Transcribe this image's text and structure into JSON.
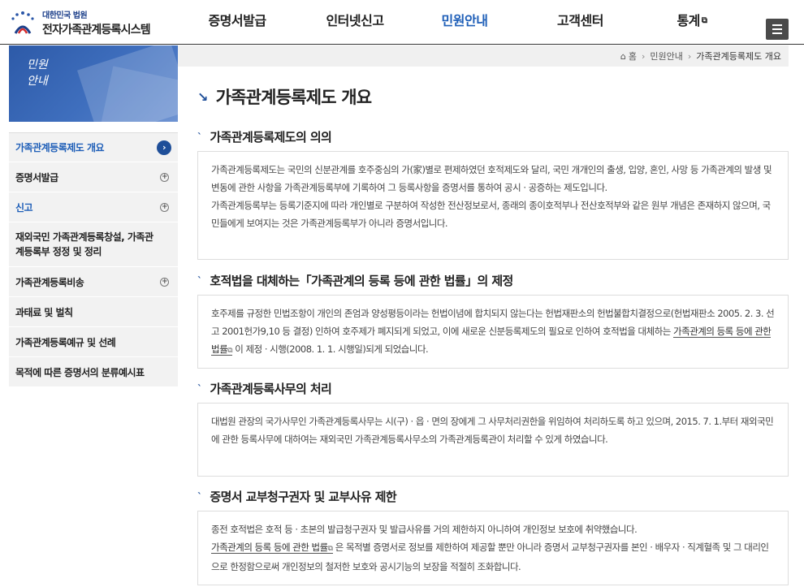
{
  "header": {
    "logo_sub": "대한민국 법원",
    "logo_main": "전자가족관계등록시스템",
    "nav": [
      {
        "label": "증명서발급"
      },
      {
        "label": "인터넷신고"
      },
      {
        "label": "민원안내"
      },
      {
        "label": "고객센터"
      },
      {
        "label": "통계"
      }
    ],
    "ext_glyph": "⧉"
  },
  "sidebar": {
    "banner_line1": "민원",
    "banner_line2": "안내",
    "items": [
      {
        "label": "가족관계등록제도 개요",
        "icon": "›"
      },
      {
        "label": "증명서발급",
        "icon": "+"
      },
      {
        "label": "신고",
        "icon": "+"
      },
      {
        "label": "재외국민 가족관계등록창설, 가족관계등록부 정정 및 정리"
      },
      {
        "label": "가족관계등록비송",
        "icon": "+"
      },
      {
        "label": "과태료 및 벌칙"
      },
      {
        "label": "가족관계등록예규 및 선례"
      },
      {
        "label": "목적에 따른 증명서의 분류예시표"
      }
    ]
  },
  "breadcrumb": {
    "home_icon": "⌂",
    "home": "홈",
    "sep": "›",
    "level1": "민원안내",
    "current": "가족관계등록제도 개요"
  },
  "content": {
    "title_mark": "↘",
    "section_mark": "`",
    "title": "가족관계등록제도 개요",
    "sections": [
      {
        "heading": "가족관계등록제도의 의의",
        "p1": "가족관계등록제도는 국민의 신분관계를 호주중심의 가(家)별로 편제하였던 호적제도와 달리, 국민 개개인의 출생, 입양, 혼인, 사망 등 가족관계의 발생 및 변동에 관한 사항을 가족관계등록부에 기록하여 그 등록사항을 증명서를 통하여 공시 · 공증하는 제도입니다.",
        "p2": "가족관계등록부는 등록기준지에 따라 개인별로 구분하여 작성한 전산정보로서, 종래의 종이호적부나 전산호적부와 같은 원부 개념은 존재하지 않으며, 국민들에게 보여지는 것은 가족관계등록부가 아니라 증명서입니다."
      },
      {
        "heading": "호적법을 대체하는「가족관계의 등록 등에 관한 법률」의 제정",
        "p1_a": "호주제를 규정한 민법조항이 개인의 존엄과 양성평등이라는 헌법이념에 합치되지 않는다는 헌법재판소의 헌법불합치결정으로(헌법재판소 2005. 2. 3. 선고 2001헌가9,10 등 결정) 인하여 호주제가 폐지되게 되었고, 이에 새로운 신분등록제도의 필요로 인하여 호적법을 대체하는",
        "p1_link": "가족관계의 등록 등에 관한 법률",
        "p1_b": "이 제정 · 시행(2008. 1. 1. 시행일)되게 되었습니다."
      },
      {
        "heading": "가족관계등록사무의 처리",
        "p1": "대법원 관장의 국가사무인 가족관계등록사무는 시(구) · 읍 · 면의 장에게 그 사무처리권한을 위임하여 처리하도록 하고 있으며, 2015. 7. 1.부터 재외국민에 관한 등록사무에 대하여는 재외국민 가족관계등록사무소의 가족관계등록관이 처리할 수 있게 하였습니다."
      },
      {
        "heading": "증명서 교부청구권자 및 교부사유 제한",
        "p1": "종전 호적법은 호적 등 · 초본의 발급청구권자 및 발급사유를 거의 제한하지 아니하여 개인정보 보호에 취약했습니다.",
        "p2_link": "가족관계의 등록 등에 관한 법률",
        "p2_b": "은 목적별 증명서로 정보를 제한하여 제공할 뿐만 아니라 증명서 교부청구권자를 본인 · 배우자 · 직계혈족 및 그 대리인으로 한정함으로써 개인정보의 철저한 보호와 공시기능의 보장을 적절히 조화합니다."
      }
    ]
  }
}
